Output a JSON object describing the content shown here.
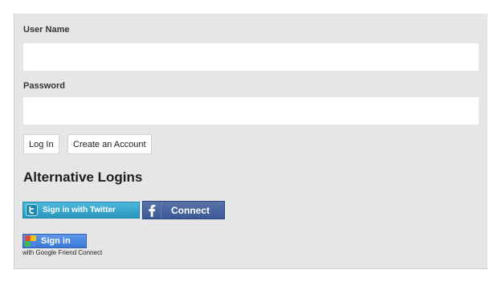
{
  "login": {
    "username_label": "User Name",
    "username_value": "",
    "password_label": "Password",
    "password_value": "",
    "login_button": "Log In",
    "create_account_button": "Create an Account"
  },
  "alternative": {
    "title": "Alternative Logins",
    "twitter": {
      "label": "Sign in with Twitter",
      "icon": "twitter-bird-icon",
      "color": "#33a8d1"
    },
    "facebook": {
      "label": "Connect",
      "icon": "facebook-f-icon",
      "color": "#3b5998"
    },
    "google": {
      "label": "Sign in",
      "icon": "google-friend-connect-icon",
      "subtitle": "with Google Friend Connect",
      "color": "#4a86e0"
    }
  }
}
